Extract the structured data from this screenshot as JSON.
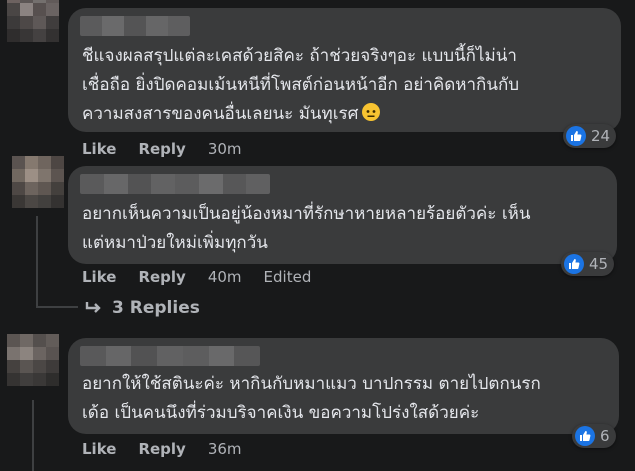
{
  "comments": [
    {
      "text": "ชีแจงผลสรุปแต่ละเคสด้วยสิคะ ถ้าช่วยจริงๆอะ แบบนี้ก็ไม่น่า\nเชื่อถือ ยิ่งปิดคอมเม้นหนีที่โพสต์ก่อนหน้าอีก อย่าคิดหากินกับ\nความสงสารของคนอื่นเลยนะ มันทุเรศ",
      "emoji": "neutral-face-emoji",
      "like": "Like",
      "reply": "Reply",
      "time": "30m",
      "edited": "",
      "reaction_count": "24"
    },
    {
      "text": "อยากเห็นความเป็นอยู่น้องหมาที่รักษาหายหลายร้อยตัวค่ะ เห็น\nแต่หมาป่วยใหม่เพิ่มทุกวัน",
      "like": "Like",
      "reply": "Reply",
      "time": "40m",
      "edited": "Edited",
      "reaction_count": "45",
      "replies_label": "3 Replies"
    },
    {
      "text": "อยากให้ใช้สตินะค่ะ หากินกับหมาแมว บาปกรรม ตายไปตกนรก\nเด้อ เป็นคนนึงที่ร่วมบริจาคเงิน ขอความโปร่งใสด้วยค่ะ",
      "like": "Like",
      "reply": "Reply",
      "time": "36m",
      "edited": "",
      "reaction_count": "6"
    }
  ],
  "colors": {
    "background": "#18191a",
    "bubble": "#3a3b3c",
    "text": "#e4e6eb",
    "muted": "#b0b3b8",
    "like_blue": "#1b74e4"
  },
  "icons": [
    "like-icon",
    "reply-arrow-icon",
    "neutral-face-emoji"
  ]
}
